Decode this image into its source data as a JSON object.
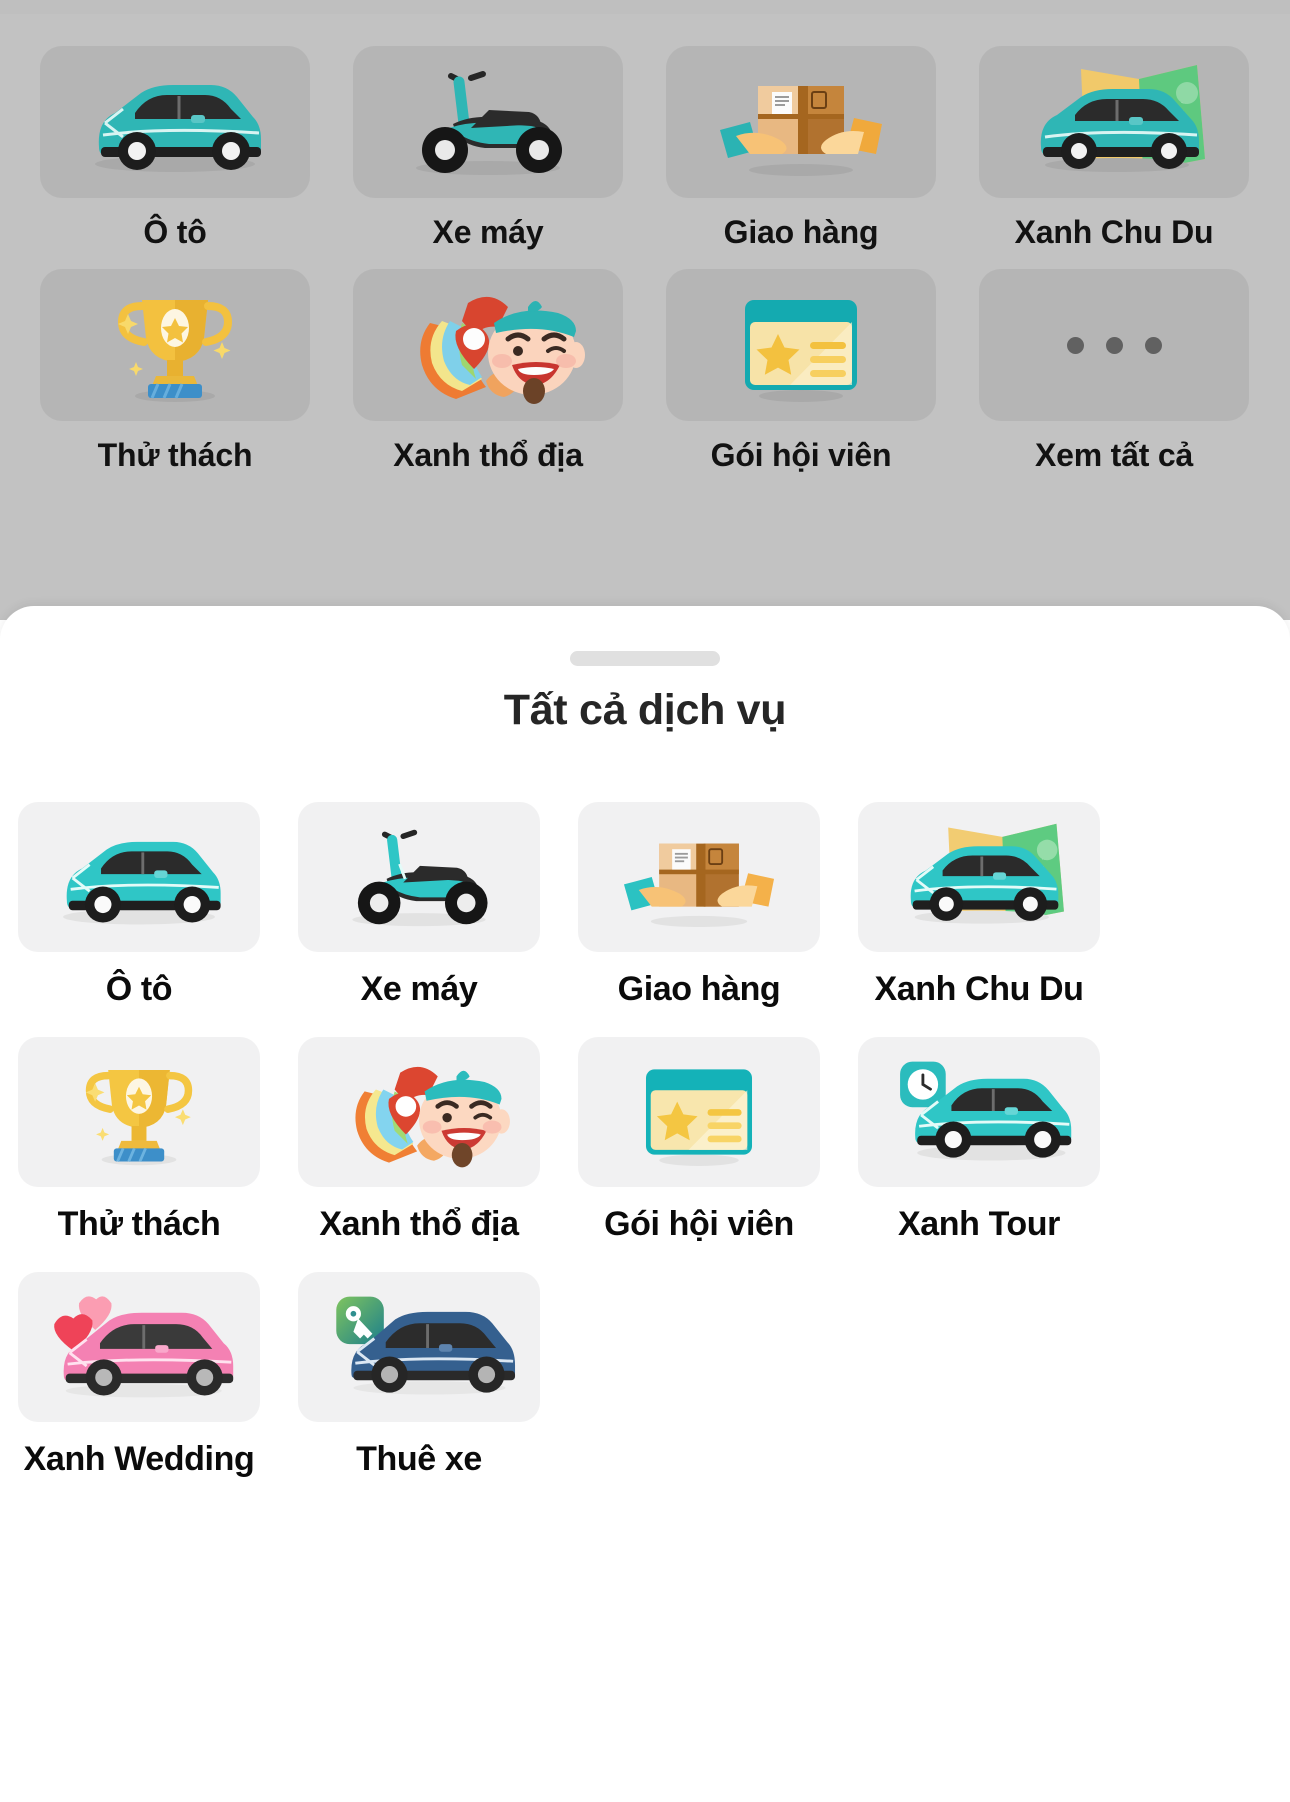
{
  "background_panel": {
    "dimmed": true,
    "overlay_color": "#c2c2c2",
    "tile_color": "#b5b5b5",
    "items": [
      {
        "label": "Ô tô",
        "icon": "teal-car-icon"
      },
      {
        "label": "Xe máy",
        "icon": "teal-scooter-icon"
      },
      {
        "label": "Giao hàng",
        "icon": "package-handoff-icon"
      },
      {
        "label": "Xanh Chu Du",
        "icon": "car-on-map-icon"
      },
      {
        "label": "Thử thách",
        "icon": "gold-trophy-icon"
      },
      {
        "label": "Xanh thổ địa",
        "icon": "local-guide-mascot-icon"
      },
      {
        "label": "Gói hội viên",
        "icon": "membership-card-icon"
      },
      {
        "label": "Xem tất cả",
        "icon": "more-dots-icon"
      }
    ]
  },
  "sheet": {
    "handle": "drag-handle",
    "title": "Tất cả dịch vụ",
    "card_color": "#f1f1f2",
    "accent_color": "#2bc4c9",
    "services": [
      {
        "label": "Ô tô",
        "icon": "teal-car-icon"
      },
      {
        "label": "Xe máy",
        "icon": "teal-scooter-icon"
      },
      {
        "label": "Giao hàng",
        "icon": "package-handoff-icon"
      },
      {
        "label": "Xanh Chu Du",
        "icon": "car-on-map-icon"
      },
      {
        "label": "Thử thách",
        "icon": "gold-trophy-icon"
      },
      {
        "label": "Xanh thổ địa",
        "icon": "local-guide-mascot-icon"
      },
      {
        "label": "Gói hội viên",
        "icon": "membership-card-icon"
      },
      {
        "label": "Xanh Tour",
        "icon": "car-with-clock-icon"
      },
      {
        "label": "Xanh Wedding",
        "icon": "pink-car-hearts-icon"
      },
      {
        "label": "Thuê xe",
        "icon": "blue-car-key-icon"
      }
    ]
  }
}
